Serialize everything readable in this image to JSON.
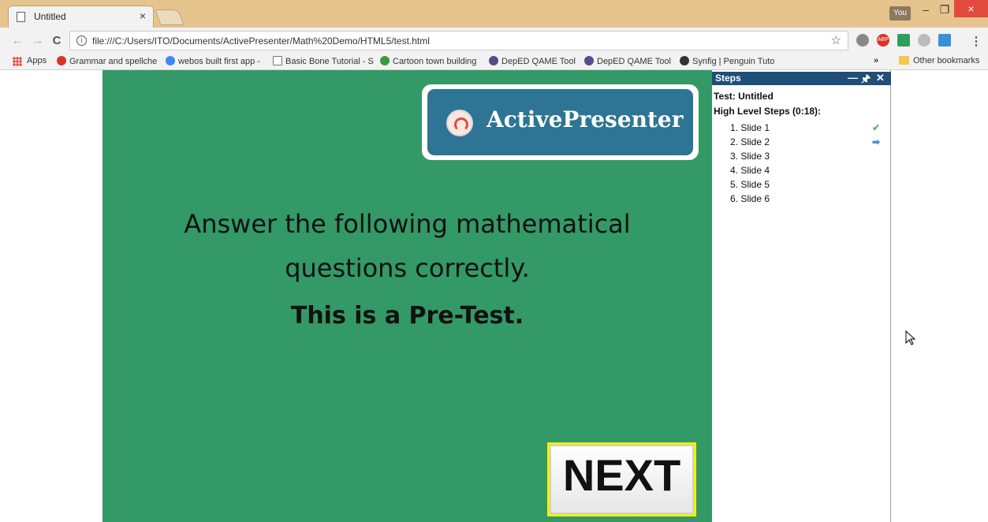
{
  "browser": {
    "tab_title": "Untitled",
    "tab_close": "×",
    "profile_label": "You",
    "minimize": "–",
    "restore": "❐",
    "close": "×",
    "back": "←",
    "forward": "→",
    "reload": "C",
    "url": "file:///C:/Users/ITO/Documents/ActivePresenter/Math%20Demo/HTML5/test.html",
    "ext_abp": "ABP"
  },
  "bookmarks": {
    "apps": "Apps",
    "items": [
      "Grammar and spellche",
      "webos built first app -",
      "Basic Bone Tutorial - S",
      "Cartoon town building",
      "DepED QAME Tool",
      "DepED QAME Tool",
      "Synfig | Penguin Tuto"
    ],
    "more": "»",
    "other": "Other bookmarks"
  },
  "slide": {
    "logo_text": "ActivePresenter",
    "headline_line1": "Answer the following mathematical",
    "headline_line2": "questions correctly.",
    "subhead": "This is a Pre-Test.",
    "next_label": "NEXT"
  },
  "steps_panel": {
    "title": "Steps",
    "ctrl_minimize": "—",
    "ctrl_pin": "🖈",
    "ctrl_close": "✕",
    "test_title": "Test: Untitled",
    "high_level": "High Level Steps (0:18):",
    "steps": [
      {
        "label": "1. Slide 1",
        "status": "✔"
      },
      {
        "label": "2. Slide 2",
        "status": "➡"
      },
      {
        "label": "3. Slide 3",
        "status": ""
      },
      {
        "label": "4. Slide 4",
        "status": ""
      },
      {
        "label": "5. Slide 5",
        "status": ""
      },
      {
        "label": "6. Slide 6",
        "status": ""
      }
    ]
  },
  "colors": {
    "slide_bg": "#339966",
    "logo_blue": "#2e7494",
    "panel_header": "#1f4e78",
    "check_green": "#5cb85c",
    "arrow_blue": "#3a8fd8"
  }
}
